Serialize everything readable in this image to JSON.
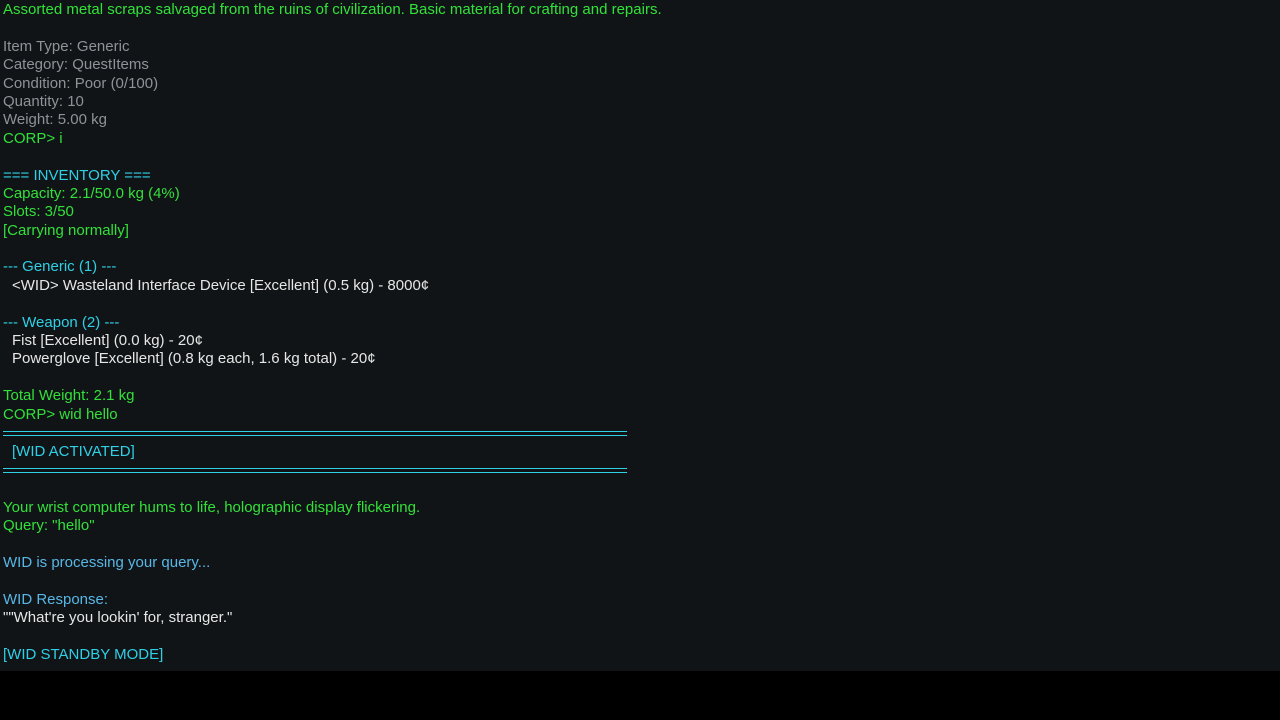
{
  "colors": {
    "background": "#101417",
    "letterbox": "#000000",
    "green": "#33e03a",
    "grey": "#8f9397",
    "cyan": "#2fd0e6",
    "white": "#e6e6e6",
    "lightblue": "#58b7e6"
  },
  "item": {
    "description": "Assorted metal scraps salvaged from the ruins of civilization. Basic material for crafting and repairs.",
    "type": "Item Type: Generic",
    "category": "Category: QuestItems",
    "condition": "Condition: Poor (0/100)",
    "quantity": "Quantity: 10",
    "weight": "Weight: 5.00 kg"
  },
  "commands": {
    "inventory": "CORP> i",
    "wid": "CORP> wid hello"
  },
  "inventory": {
    "header": "=== INVENTORY ===",
    "capacity": "Capacity: 2.1/50.0 kg (4%)",
    "slots": "Slots: 3/50",
    "status": "[Carrying normally]",
    "groups": {
      "generic": {
        "header": "--- Generic (1) ---",
        "items": [
          "<WID> Wasteland Interface Device [Excellent] (0.5 kg) - 8000¢"
        ]
      },
      "weapon": {
        "header": "--- Weapon (2) ---",
        "items": [
          "Fist [Excellent] (0.0 kg) - 20¢",
          "Powerglove [Excellent] (0.8 kg each, 1.6 kg total) - 20¢"
        ]
      }
    },
    "total_weight": "Total Weight: 2.1 kg"
  },
  "wid": {
    "activated": "[WID ACTIVATED]",
    "hum": "Your wrist computer hums to life, holographic display flickering.",
    "query": "Query: \"hello\"",
    "processing": "WID is processing your query...",
    "response_label": "WID Response:",
    "response_text": "\"\"What're you lookin' for, stranger.\"",
    "standby": "[WID STANDBY MODE]"
  }
}
